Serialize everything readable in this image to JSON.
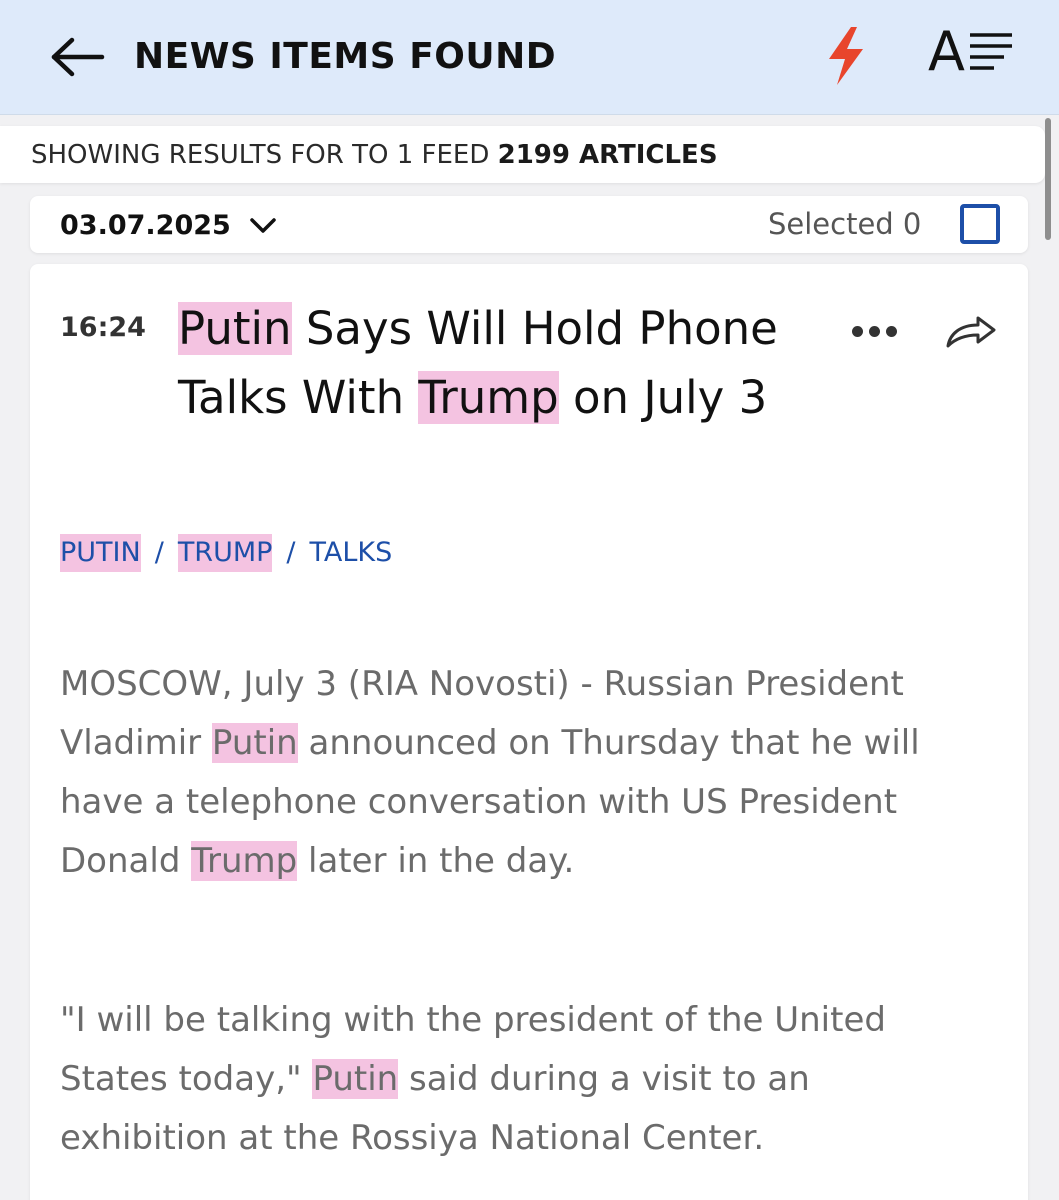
{
  "header": {
    "title": "NEWS ITEMS FOUND",
    "icons": {
      "back": "arrow-left-icon",
      "flash": "lightning-bolt-icon",
      "text_size": "font-size-icon",
      "more": "more-dots-icon",
      "share": "share-arrow-icon",
      "chevron": "chevron-down-icon",
      "checkbox": "checkbox-icon"
    },
    "colors": {
      "header_bg": "#deeafa",
      "bolt": "#e8452c",
      "accent": "#1d4fa8",
      "highlight": "#f4c3e1"
    }
  },
  "results": {
    "prefix": "SHOWING RESULTS FOR TO 1 FEED",
    "count": "2199 ARTICLES"
  },
  "date_bar": {
    "date": "03.07.2025",
    "selected_label": "Selected 0"
  },
  "article": {
    "time": "16:24",
    "title_parts": {
      "t1": "Putin",
      "t2": " Says Will Hold Phone Talks With ",
      "t3": "Trump",
      "t4": " on July 3"
    },
    "tags": [
      "PUTIN",
      "TRUMP",
      "TALKS"
    ],
    "tag_separator": "/",
    "p1": {
      "a": "MOSCOW, July 3 (RIA Novosti) - Russian President Vladimir ",
      "b": "Putin",
      "c": " announced on Thursday that he will have a telephone conversation with US President Donald ",
      "d": "Trump",
      "e": " later in the day."
    },
    "p2": {
      "a": "\"I will be talking with the president of the United States today,\" ",
      "b": "Putin",
      "c": " said during a visit to an exhibition at the Rossiya National Center."
    }
  }
}
